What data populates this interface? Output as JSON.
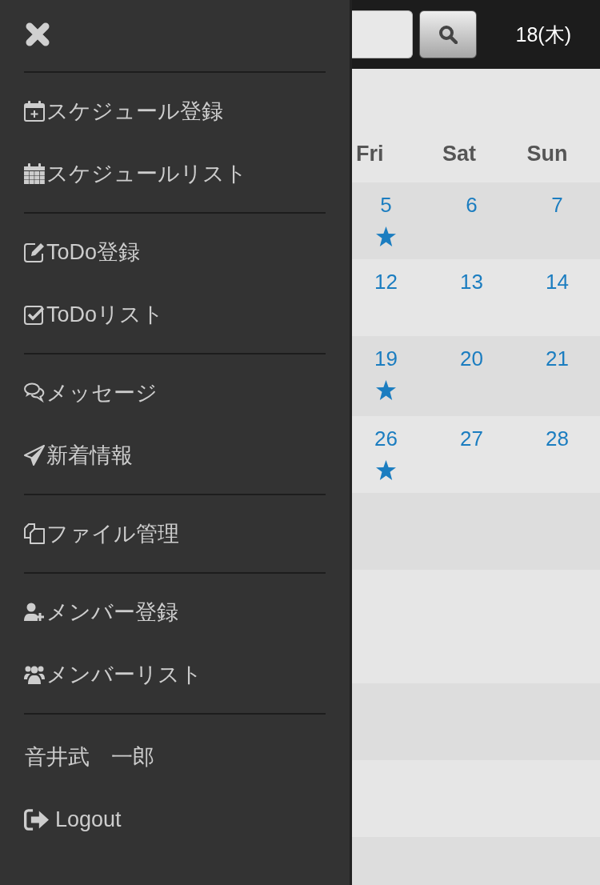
{
  "menu": {
    "sections": [
      {
        "items": [
          {
            "label": "スケジュール登録"
          },
          {
            "label": "スケジュールリスト"
          }
        ]
      },
      {
        "items": [
          {
            "label": "ToDo登録"
          },
          {
            "label": "ToDoリスト"
          }
        ]
      },
      {
        "items": [
          {
            "label": "メッセージ"
          },
          {
            "label": "新着情報"
          }
        ]
      },
      {
        "items": [
          {
            "label": "ファイル管理"
          }
        ]
      },
      {
        "items": [
          {
            "label": "メンバー登録"
          },
          {
            "label": "メンバーリスト"
          }
        ]
      }
    ],
    "user_name": "音井武　一郎",
    "logout": {
      "label": "Logout"
    }
  },
  "top_bar": {
    "date": "18(木)"
  },
  "calendar": {
    "weekdays": [
      "Fri",
      "Sat",
      "Sun"
    ],
    "weeks": [
      [
        {
          "day": "5",
          "marked": true
        },
        {
          "day": "6",
          "marked": false
        },
        {
          "day": "7",
          "marked": false
        }
      ],
      [
        {
          "day": "12",
          "marked": false
        },
        {
          "day": "13",
          "marked": false
        },
        {
          "day": "14",
          "marked": false
        }
      ],
      [
        {
          "day": "19",
          "marked": true
        },
        {
          "day": "20",
          "marked": false
        },
        {
          "day": "21",
          "marked": false
        }
      ],
      [
        {
          "day": "26",
          "marked": true
        },
        {
          "day": "27",
          "marked": false
        },
        {
          "day": "28",
          "marked": false
        }
      ]
    ]
  }
}
